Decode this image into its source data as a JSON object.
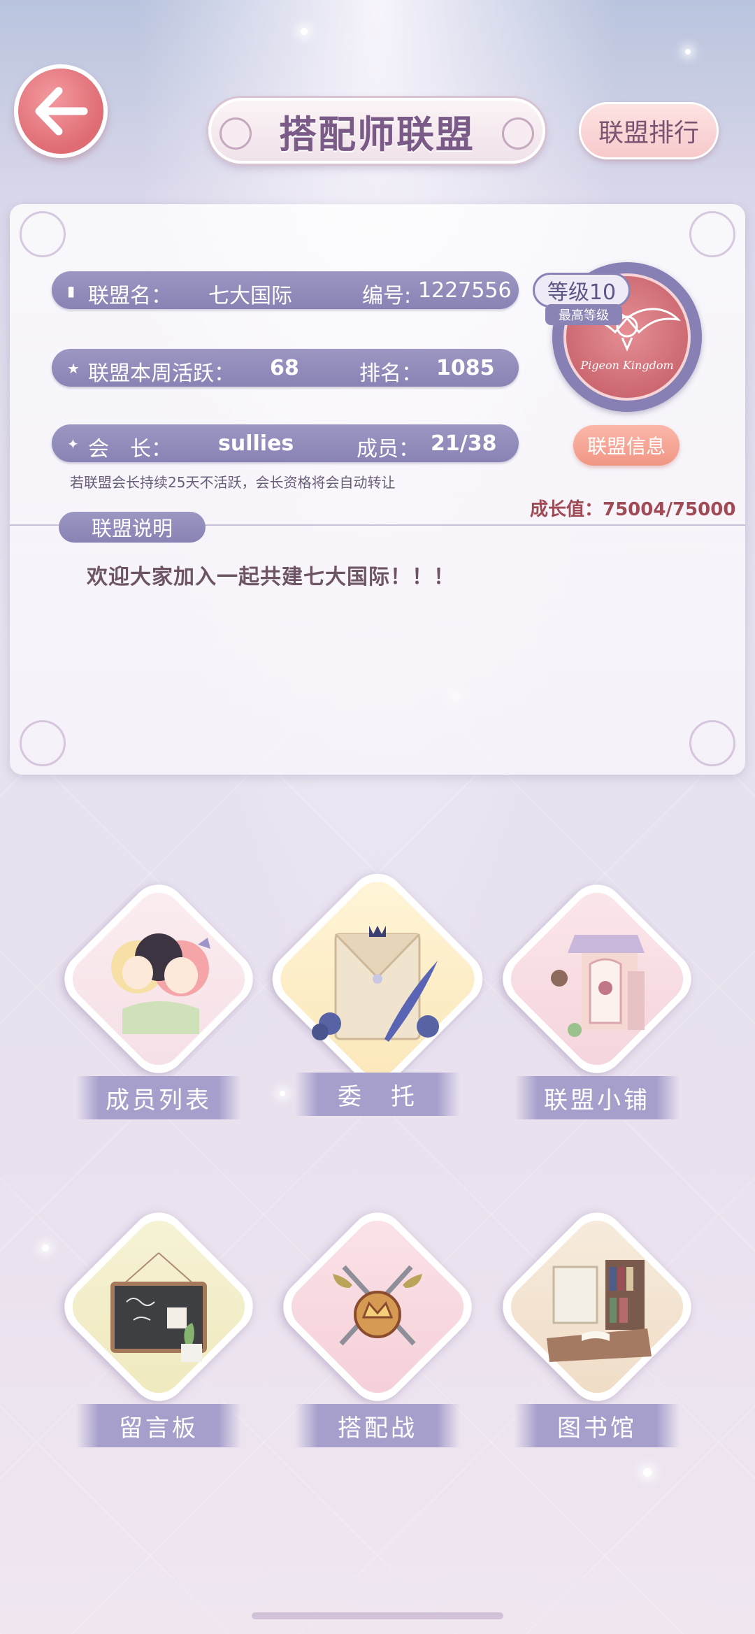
{
  "header": {
    "title": "搭配师联盟",
    "rank_button": "联盟排行"
  },
  "alliance": {
    "name_key": "联盟名：",
    "name_value": "七大国际",
    "id_key": "编号:",
    "id_value": "1227556",
    "activity_key": "联盟本周活跃：",
    "activity_value": "68",
    "rank_key": "排名：",
    "rank_value": "1085",
    "leader_key": "会　长：",
    "leader_value": "sullies",
    "members_key": "成员：",
    "members_value": "21/38",
    "warning": "若联盟会长持续25天不活跃，会长资格将会自动转让",
    "level": "等级10",
    "max_level": "最高等级",
    "emblem_text": "Pigeon Kingdom",
    "info_button": "联盟信息",
    "growth": "成长值：75004/75000",
    "desc_title": "联盟说明",
    "desc": "欢迎大家加入一起共建七大国际！！！"
  },
  "features": [
    {
      "label": "成员列表",
      "icon": "members-icon"
    },
    {
      "label": "委　托",
      "icon": "commission-icon"
    },
    {
      "label": "联盟小铺",
      "icon": "shop-icon"
    },
    {
      "label": "留言板",
      "icon": "message-board-icon"
    },
    {
      "label": "搭配战",
      "icon": "battle-icon"
    },
    {
      "label": "图书馆",
      "icon": "library-icon"
    }
  ],
  "colors": {
    "accent_purple": "#8983b5",
    "accent_red": "#df6b73",
    "text_brown": "#6e5565"
  }
}
